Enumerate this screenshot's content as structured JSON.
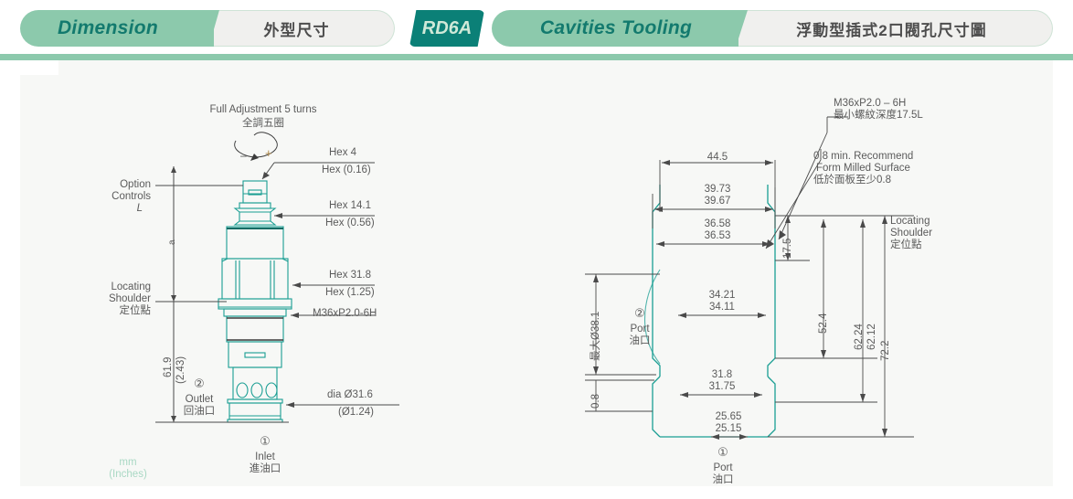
{
  "header": {
    "tabs": [
      {
        "label": "Dimension",
        "kind": "en"
      },
      {
        "label": "外型尺寸",
        "kind": "cn"
      },
      {
        "label": "RD6A",
        "kind": "code"
      },
      {
        "label": "Cavities Tooling",
        "kind": "en"
      },
      {
        "label": "浮動型插式2口閥孔尺寸圖",
        "kind": "cn"
      }
    ],
    "accent_green": "#8cc9ac",
    "accent_teal": "#0b8077",
    "en_text_color": "#137a6e"
  },
  "left_drawing": {
    "title_en": "Full Adjustment 5 turns",
    "title_cn": "全調五圈",
    "minus": "–",
    "plus": "+",
    "option_controls": [
      "Option",
      "Controls",
      "L"
    ],
    "dim_a": "a",
    "locating_en": [
      "Locating",
      "Shoulder"
    ],
    "locating_cn": "定位點",
    "height_mm": "61.9",
    "height_in": "(2.43)",
    "callouts": [
      {
        "line1": "Hex 4",
        "line2": "Hex (0.16)"
      },
      {
        "line1": "Hex 14.1",
        "line2": "Hex (0.56)"
      },
      {
        "line1": "Hex 31.8",
        "line2": "Hex (1.25)"
      },
      {
        "line1": "M36xP2.0-6H",
        "line2": ""
      },
      {
        "line1": "dia  Ø31.6",
        "line2": "(Ø1.24)"
      }
    ],
    "port_outlet_num": "②",
    "port_outlet_en": "Outlet",
    "port_outlet_cn": "回油口",
    "port_inlet_num": "①",
    "port_inlet_en": "Inlet",
    "port_inlet_cn": "進油口",
    "units_line1": "mm",
    "units_line2": "(Inches)"
  },
  "right_drawing": {
    "note_thread_en": "M36xP2.0 – 6H",
    "note_thread_cn": "最小螺紋深度17.5L",
    "note_surface_en1": "0.8 min. Recommend",
    "note_surface_en2": "Form Milled Surface",
    "note_surface_cn": "低於面板至少0.8",
    "locating_en": [
      "Locating",
      "Shoulder"
    ],
    "locating_cn": "定位點",
    "dims_horizontal": [
      {
        "value": "44.5",
        "tol": ""
      },
      {
        "value": "39.73",
        "tol": "39.67"
      },
      {
        "value": "36.58",
        "tol": "36.53"
      },
      {
        "value": "34.21",
        "tol": "34.11"
      },
      {
        "value": "31.8",
        "tol": "31.75"
      },
      {
        "value": "25.65",
        "tol": "25.15"
      }
    ],
    "dims_vertical": [
      {
        "value": "最大Ø38.1"
      },
      {
        "value": "0.8"
      },
      {
        "value": "17.5"
      },
      {
        "value": "52.4"
      },
      {
        "value": "62.24"
      },
      {
        "value": "62.12"
      },
      {
        "value": "72.2"
      }
    ],
    "port2_num": "②",
    "port2_en": "Port",
    "port2_cn": "油口",
    "port1_num": "①",
    "port1_en": "Port",
    "port1_cn": "油口"
  },
  "colors": {
    "teal_line": "#1a9e93",
    "dim_line": "#4a4a4a",
    "text": "#5b5b5b",
    "panel_bg": "#f7f8f6"
  }
}
